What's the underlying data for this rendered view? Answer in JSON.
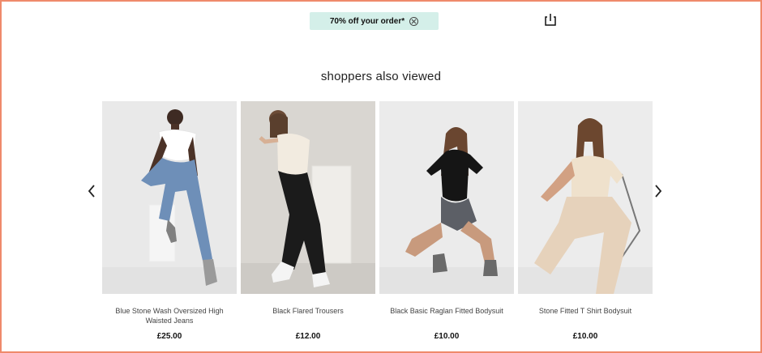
{
  "promo": {
    "label": "70% off your order*",
    "close_icon": "close-circle-icon"
  },
  "toolbar": {
    "share_icon": "share-icon"
  },
  "section": {
    "title": "shoppers also viewed"
  },
  "carousel": {
    "prev_icon": "chevron-left-icon",
    "next_icon": "chevron-right-icon",
    "items": [
      {
        "name": "Blue Stone Wash Oversized High Waisted Jeans",
        "price": "£25.00"
      },
      {
        "name": "Black Flared Trousers",
        "price": "£12.00"
      },
      {
        "name": "Black Basic Raglan Fitted Bodysuit",
        "price": "£10.00"
      },
      {
        "name": "Stone Fitted T Shirt Bodysuit",
        "price": "£10.00"
      }
    ]
  },
  "colors": {
    "border": "#ef8a6b",
    "promo_bg": "#d4efe9"
  }
}
